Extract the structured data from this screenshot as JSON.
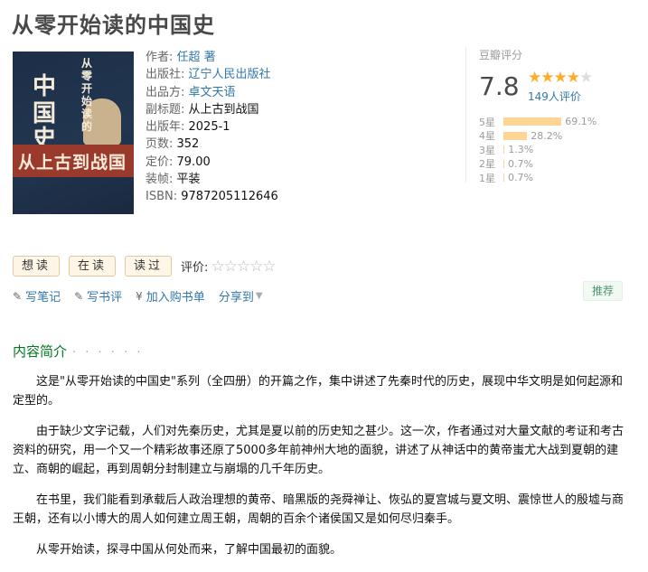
{
  "title": "从零开始读的中国史",
  "cover": {
    "big_text": "中国史",
    "vertical_text": "从零开始读的",
    "band_text": "从上古到战国"
  },
  "info": [
    {
      "label": "作者:",
      "value": "任超 著",
      "link": true
    },
    {
      "label": "出版社:",
      "value": "辽宁人民出版社",
      "link": true
    },
    {
      "label": "出品方:",
      "value": "卓文天语",
      "link": true
    },
    {
      "label": "副标题:",
      "value": "从上古到战国",
      "link": false
    },
    {
      "label": "出版年:",
      "value": "2025-1",
      "link": false
    },
    {
      "label": "页数:",
      "value": "352",
      "link": false
    },
    {
      "label": "定价:",
      "value": "79.00",
      "link": false
    },
    {
      "label": "装帧:",
      "value": "平装",
      "link": false
    },
    {
      "label": "ISBN:",
      "value": "9787205112646",
      "link": false
    }
  ],
  "rating": {
    "header": "豆瓣评分",
    "score": "7.8",
    "stars_filled": 4,
    "votes": "149人评价",
    "distribution": [
      {
        "label": "5星",
        "percent": "69.1%",
        "value": 69.1
      },
      {
        "label": "4星",
        "percent": "28.2%",
        "value": 28.2
      },
      {
        "label": "3星",
        "percent": "1.3%",
        "value": 1.3
      },
      {
        "label": "2星",
        "percent": "0.7%",
        "value": 0.7
      },
      {
        "label": "1星",
        "percent": "0.7%",
        "value": 0.7
      }
    ]
  },
  "actions": {
    "want": "想读",
    "reading": "在读",
    "read": "读过",
    "rate_label": "评价:"
  },
  "links": {
    "write_note": "写笔记",
    "write_review": "写书评",
    "add_cart": "加入购书单",
    "share": "分享到",
    "recommend": "推荐"
  },
  "section_title": "内容简介",
  "intro": [
    "这是\"从零开始读的中国史\"系列（全四册）的开篇之作，集中讲述了先秦时代的历史，展现中华文明是如何起源和定型的。",
    "由于缺少文字记载，人们对先秦历史，尤其是夏以前的历史知之甚少。这一次，作者通过对大量文献的考证和考古资料的研究，用一个又一个精彩故事还原了5000多年前神州大地的面貌，讲述了从神话中的黄帝蚩尤大战到夏朝的建立、商朝的崛起，再到周朝分封制建立与崩塌的几千年历史。",
    "在书里，我们能看到承载后人政治理想的黄帝、暗黑版的尧舜禅让、恢弘的夏宫城与夏文明、震惊世人的殷墟与商王朝，还有以小博大的周人如何建立周王朝，周朝的百余个诸侯国又是如何尽归秦手。",
    "从零开始读，探寻中国从何处而来，了解中国最初的面貌。"
  ]
}
